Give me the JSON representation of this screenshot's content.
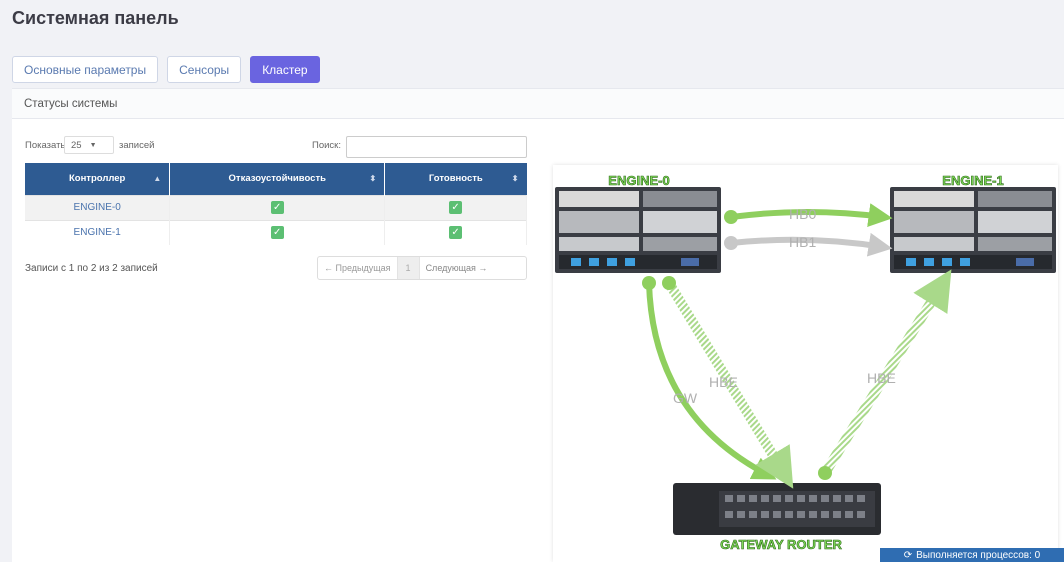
{
  "page": {
    "title": "Системная панель"
  },
  "tabs": [
    {
      "label": "Основные параметры",
      "active": false
    },
    {
      "label": "Сенсоры",
      "active": false
    },
    {
      "label": "Кластер",
      "active": true
    }
  ],
  "panel": {
    "title": "Статусы системы"
  },
  "table_controls": {
    "show_label": "Показать",
    "page_length": "25",
    "records_label": "записей",
    "search_label": "Поиск:",
    "search_value": ""
  },
  "table": {
    "columns": [
      "Контроллер",
      "Отказоустойчивость",
      "Готовность"
    ],
    "rows": [
      {
        "controller": "ENGINE-0",
        "fault_tolerance": "✓",
        "readiness": "✓"
      },
      {
        "controller": "ENGINE-1",
        "fault_tolerance": "✓",
        "readiness": "✓"
      }
    ],
    "info": "Записи с 1 по 2 из 2 записей",
    "pagination": {
      "prev": "← Предыдущая",
      "page": "1",
      "next": "Следующая →"
    }
  },
  "diagram": {
    "nodes": {
      "engine0": "ENGINE-0",
      "engine1": "ENGINE-1",
      "router": "GATEWAY ROUTER"
    },
    "links": {
      "hb0": "HB0",
      "hb1": "HB1",
      "hbe_left": "HBE",
      "gw": "GW",
      "hbe_right": "HBE"
    },
    "colors": {
      "active_link": "#8fcf5e",
      "inactive_link": "#c8c8c8",
      "node_label": "#7ed957"
    }
  },
  "status_bar": {
    "icon": "sync-icon",
    "text": "Выполняется процессов: 0"
  }
}
